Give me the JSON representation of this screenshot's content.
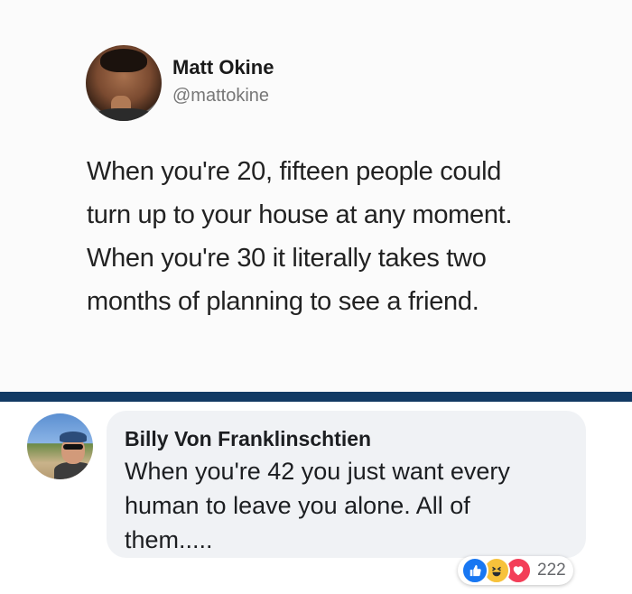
{
  "tweet": {
    "name": "Matt Okine",
    "handle": "@mattokine",
    "lines": [
      "When you're 20, fifteen people could",
      "turn up to your house at any moment.",
      "When you're 30 it literally takes two",
      "months of planning to see a friend."
    ]
  },
  "comment": {
    "name": "Billy Von Franklinschtien",
    "lines": [
      "When you're 42 you just want every",
      "human to leave you alone. All of",
      "them....."
    ],
    "reactions": {
      "icons": [
        "like-icon",
        "haha-icon",
        "love-icon"
      ],
      "count": "222"
    }
  },
  "colors": {
    "divider": "#123a64",
    "like": "#1877f2",
    "haha": "#f7c23b",
    "love": "#f33e58"
  }
}
